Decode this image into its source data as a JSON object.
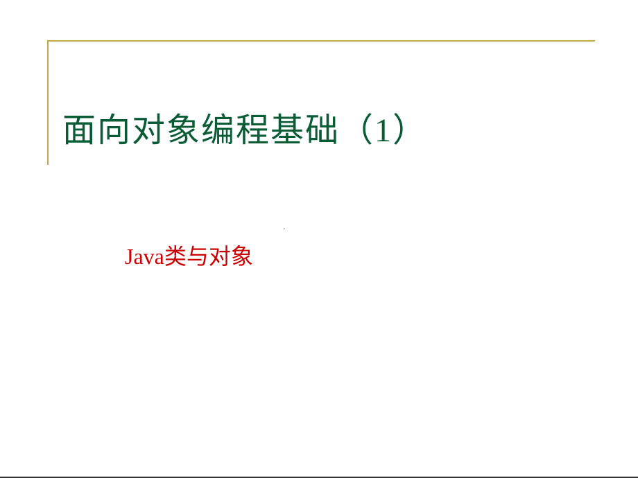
{
  "slide": {
    "title": "面向对象编程基础（1）",
    "subtitle": "Java类与对象",
    "dot": "."
  },
  "colors": {
    "title_color": "#0a5c36",
    "subtitle_color": "#cc0000",
    "frame_color": "#c2a84a"
  }
}
